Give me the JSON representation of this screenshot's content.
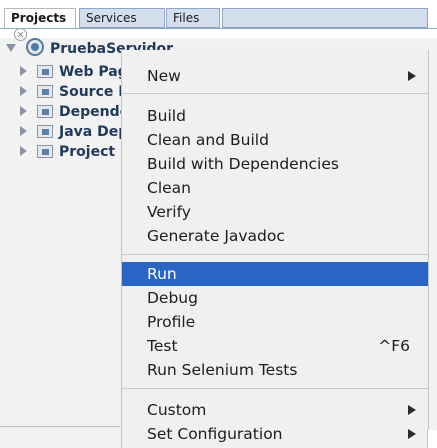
{
  "tabs": {
    "projects": "Projects",
    "services": "Services",
    "files": "Files"
  },
  "tree": {
    "root_label": "PruebaServidor",
    "items": [
      {
        "label": "Web Pages"
      },
      {
        "label": "Source Packages"
      },
      {
        "label": "Dependencies"
      },
      {
        "label": "Java Dependencies"
      },
      {
        "label": "Project Files"
      }
    ]
  },
  "menu": {
    "new": "New",
    "build": "Build",
    "clean_and_build": "Clean and Build",
    "build_with_dependencies": "Build with Dependencies",
    "clean": "Clean",
    "verify": "Verify",
    "generate_javadoc": "Generate Javadoc",
    "run": "Run",
    "debug": "Debug",
    "profile": "Profile",
    "test": "Test",
    "test_shortcut": "^F6",
    "run_selenium_tests": "Run Selenium Tests",
    "custom": "Custom",
    "set_configuration": "Set Configuration"
  },
  "colors": {
    "selection": "#2a64c5",
    "tab_inactive": "#d4dfee",
    "tree_text": "#1f3a5a"
  },
  "icons": {
    "root": "project-globe-icon",
    "folder": "package-folder-icon",
    "submenu": "submenu-arrow-icon"
  }
}
